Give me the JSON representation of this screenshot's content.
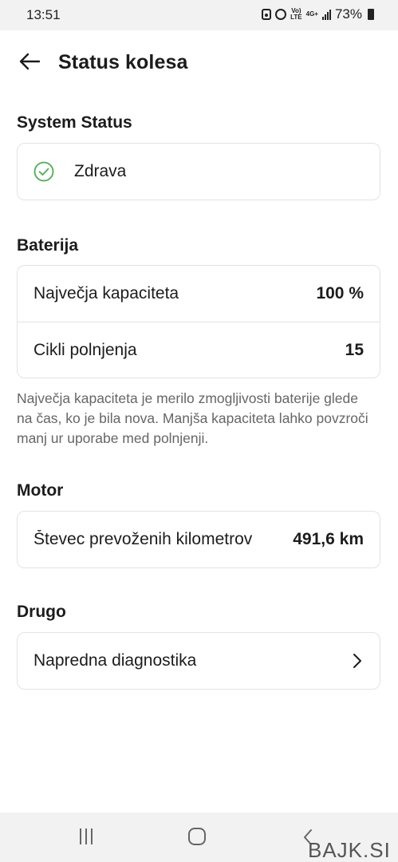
{
  "status_bar": {
    "time": "13:51",
    "network_top": "Vo)",
    "network_bottom": "LTE",
    "net_gen": "4G+",
    "battery_percent": "73%",
    "icons": [
      "battery-saver-icon",
      "alarm-icon",
      "volte-icon",
      "4g-plus-icon",
      "signal-icon",
      "battery-icon"
    ]
  },
  "header": {
    "back_icon": "arrow-left-icon",
    "title": "Status kolesa"
  },
  "system_status": {
    "title": "System Status",
    "status_icon": "check-circle-icon",
    "status_color": "#4caf50",
    "status_text": "Zdrava"
  },
  "battery": {
    "title": "Baterija",
    "rows": [
      {
        "label": "Največja kapaciteta",
        "value": "100 %"
      },
      {
        "label": "Cikli polnjenja",
        "value": "15"
      }
    ],
    "note": "Največja kapaciteta je merilo zmogljivosti baterije glede na čas, ko je bila nova. Manjša kapaciteta lahko povzroči manj ur uporabe med polnjenji."
  },
  "motor": {
    "title": "Motor",
    "rows": [
      {
        "label": "Števec prevoženih kilometrov",
        "value": "491,6 km"
      }
    ]
  },
  "other": {
    "title": "Drugo",
    "rows": [
      {
        "label": "Napredna diagnostika",
        "icon": "chevron-right-icon"
      }
    ]
  },
  "nav_bar": {
    "icons": [
      "recents-icon",
      "home-icon",
      "back-icon"
    ]
  },
  "watermark": "BAJK.SI"
}
